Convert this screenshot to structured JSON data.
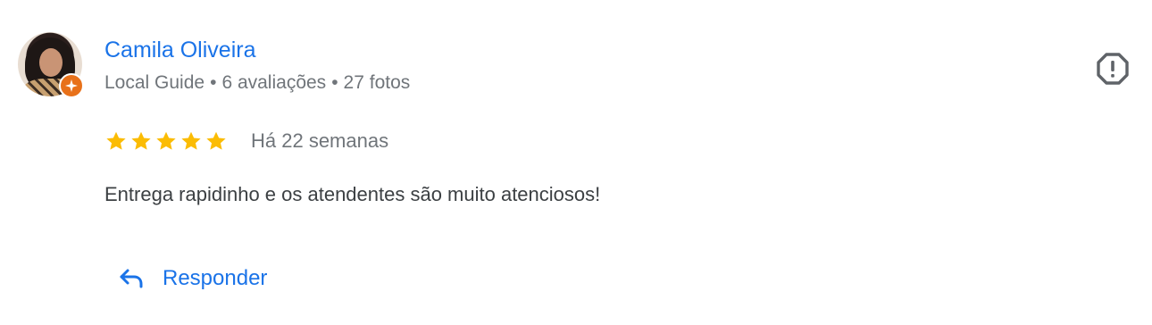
{
  "review": {
    "author_name": "Camila Oliveira",
    "author_meta": {
      "guide": "Local Guide",
      "reviews": "6 avaliações",
      "photos": "27 fotos",
      "separator": "•"
    },
    "rating": 5,
    "time": "Há 22 semanas",
    "text": "Entrega rapidinho e os atendentes são muito atenciosos!",
    "reply_label": "Responder"
  },
  "icons": {
    "report": "report-octagon-icon",
    "reply": "reply-arrow-icon",
    "star": "star-icon",
    "guide_badge": "local-guide-star-icon"
  },
  "colors": {
    "link": "#1a73e8",
    "secondary_text": "#70757a",
    "body_text": "#3c4043",
    "star": "#fbbc04",
    "guide_badge": "#e8711a"
  }
}
